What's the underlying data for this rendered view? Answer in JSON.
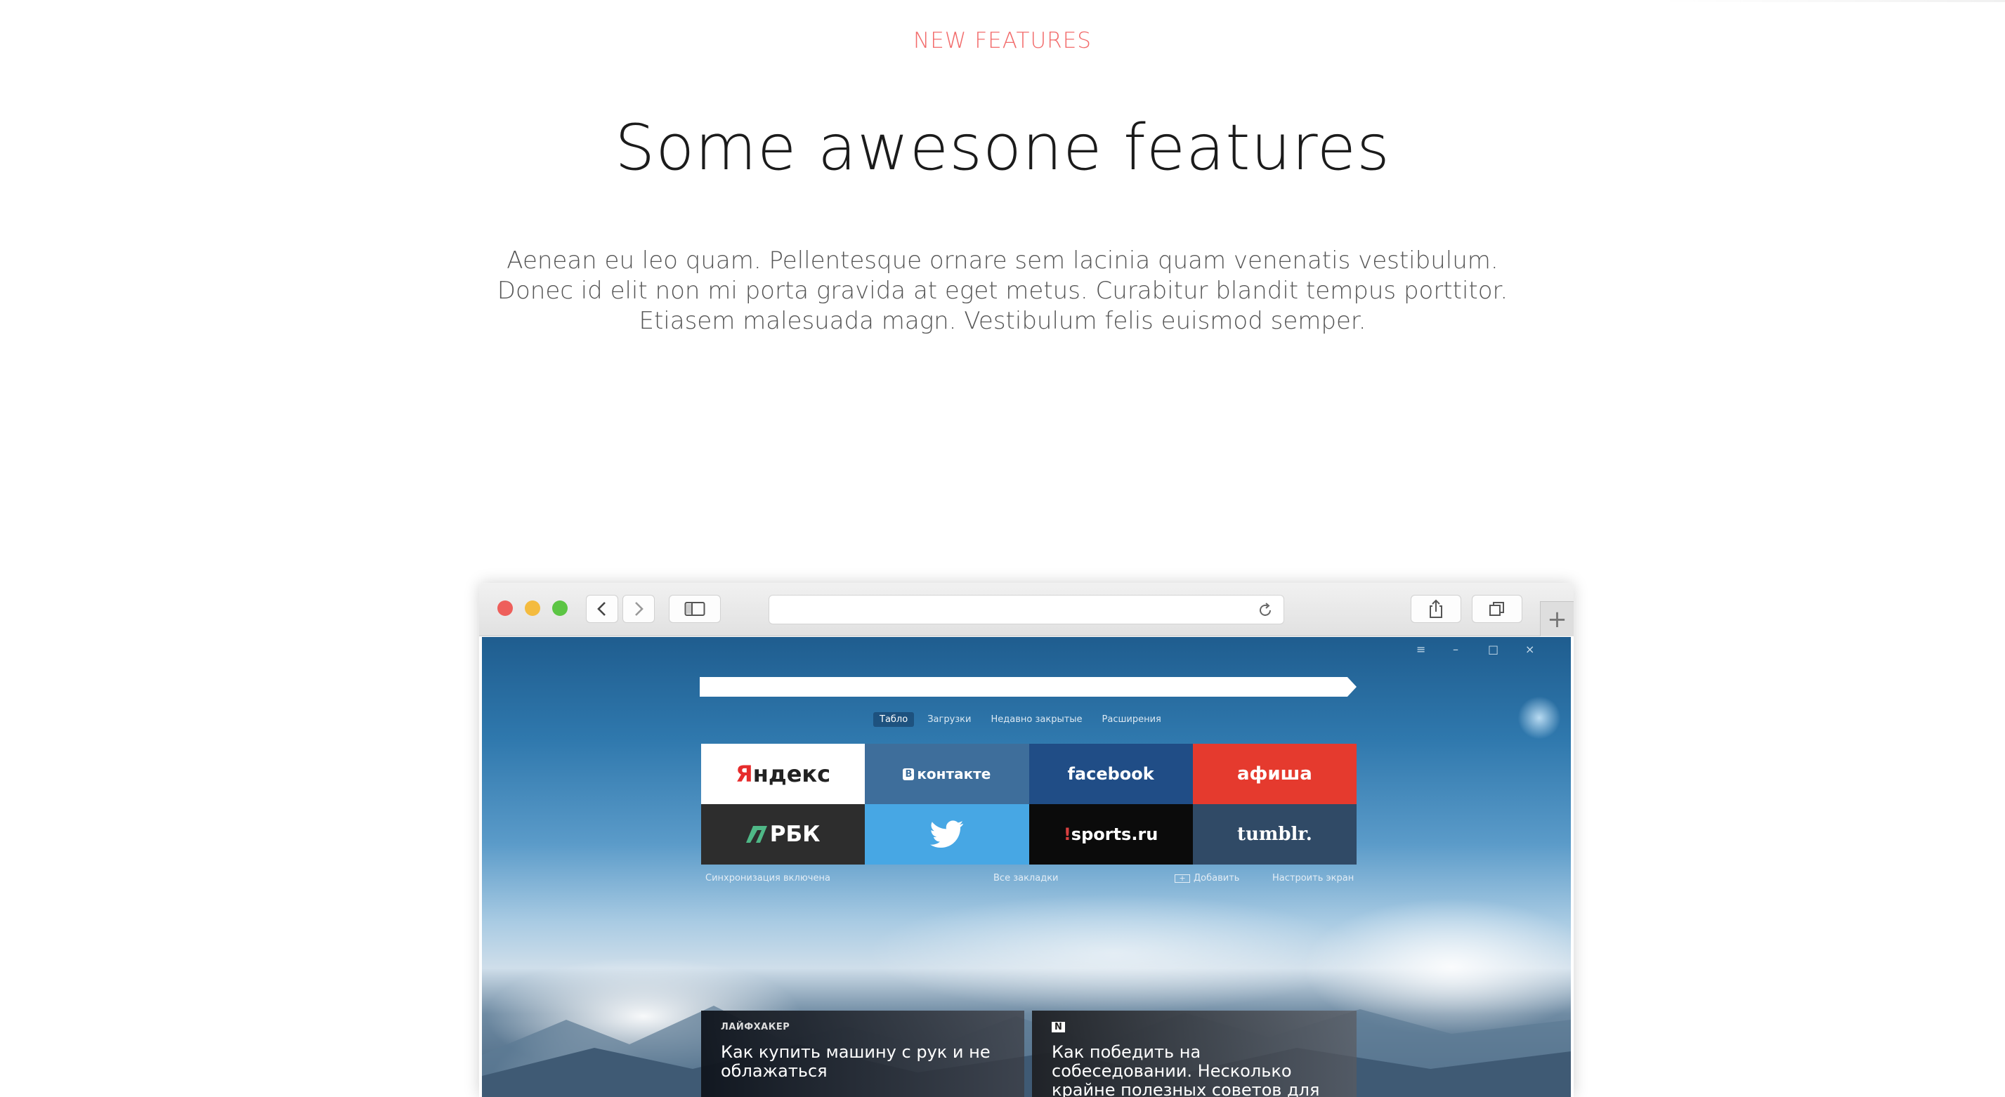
{
  "section": {
    "eyebrow": "NEW FEATURES",
    "title": "Some awesone features",
    "lead_lines": [
      "Aenean eu leo quam. Pellentesque ornare sem lacinia quam venenatis vestibulum.",
      "Donec id elit non mi porta gravida at eget metus. Curabitur blandit tempus porttitor.",
      "Etiasem malesuada magn. Vestibulum felis euismod semper."
    ]
  },
  "browser": {
    "new_tab_glyph": "+",
    "icons": [
      "back-icon",
      "forward-icon",
      "sidebar-icon",
      "reload-icon",
      "share-icon",
      "tabs-icon"
    ],
    "window_controls": [
      "≡",
      "–",
      "□",
      "×"
    ],
    "tabs": [
      "Табло",
      "Загрузки",
      "Недавно закрытые",
      "Расширения"
    ],
    "tiles": [
      {
        "label_first": "Я",
        "label_rest": "ндекс"
      },
      {
        "label": "контакте",
        "badge": "В"
      },
      {
        "label": "facebook"
      },
      {
        "label": "афиша"
      },
      {
        "label": "РБК"
      },
      {
        "icon": "twitter-bird-icon"
      },
      {
        "label": "sports.ru",
        "prefix": "!"
      },
      {
        "label": "tumblr."
      }
    ],
    "footer": {
      "sync": "Синхронизация включена",
      "bookmarks": "Все закладки",
      "add": "Добавить",
      "customize": "Настроить экран"
    },
    "news": [
      {
        "source": "ЛАЙФХАКЕР",
        "title": "Как купить машину с рук и не облажаться"
      },
      {
        "source": "N",
        "title": "Как победить на собеседовании. Несколько крайне полезных советов для"
      }
    ],
    "colors": {
      "eyebrow": "#f26b6b",
      "yandex_red": "#e62c2c",
      "vk": "#3e6e9b",
      "facebook": "#204d86",
      "afisha": "#e53a2e",
      "twitter": "#47a7e4",
      "tumblr": "#304a66"
    }
  }
}
